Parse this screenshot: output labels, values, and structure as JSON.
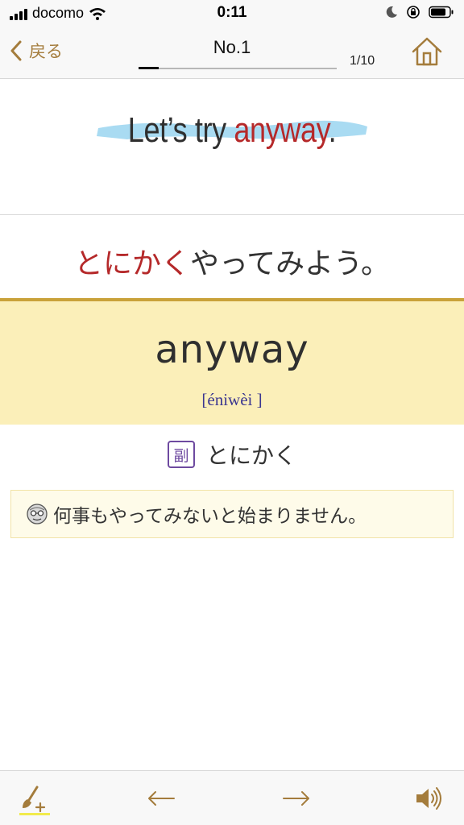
{
  "status_bar": {
    "carrier": "docomo",
    "time": "0:11"
  },
  "nav": {
    "back_label": "戻る",
    "title": "No.1",
    "counter": "1/10",
    "progress_fraction": 0.1
  },
  "sentence": {
    "en_prefix": "Let’s try ",
    "en_keyword": "anyway",
    "en_suffix": ".",
    "ja_keyword": "とにかく",
    "ja_rest": "やってみよう。"
  },
  "word": {
    "headword": "anyway",
    "pronunciation": "[éniwèi ]",
    "pos_badge": "副",
    "meaning": "とにかく"
  },
  "example": {
    "text": "何事もやってみないと始まりません。"
  },
  "icons": {
    "back": "chevron-left-icon",
    "home": "home-icon",
    "edit": "brush-plus-icon",
    "prev": "arrow-left-icon",
    "next": "arrow-right-icon",
    "sound": "speaker-icon"
  },
  "colors": {
    "accent_gold": "#a47c3c",
    "keyword_red": "#b5292a",
    "word_panel": "#fbefb9",
    "highlight_blue": "#a9dbf2",
    "pos_purple": "#6e4aa0"
  }
}
